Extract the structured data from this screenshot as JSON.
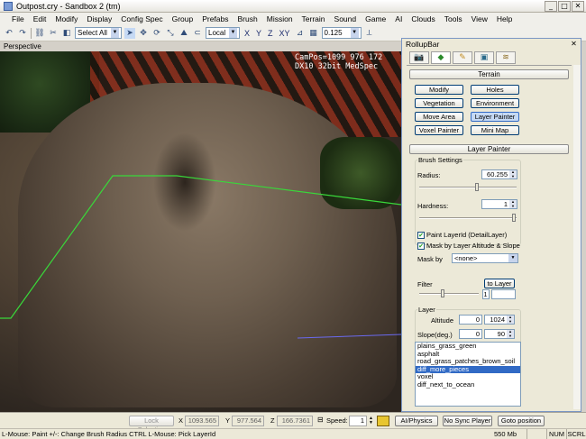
{
  "window": {
    "title": "Outpost.cry - Sandbox 2 (tm)",
    "minimize": "_",
    "maximize": "□",
    "close": "✕"
  },
  "menu": [
    "File",
    "Edit",
    "Modify",
    "Display",
    "Config Spec",
    "Group",
    "Prefabs",
    "Brush",
    "Mission",
    "Terrain",
    "Sound",
    "Game",
    "AI",
    "Clouds",
    "Tools",
    "View",
    "Help"
  ],
  "toolbar": {
    "selection": "Select All",
    "coord_space": "Local",
    "axes": [
      "X",
      "Y",
      "Z",
      "XY"
    ],
    "grid_value": "0.125"
  },
  "viewport": {
    "label": "Perspective",
    "camera_line1": "CamPos=1099 976 172",
    "camera_line2": "DX10 32bit MedSpec"
  },
  "rollup": {
    "title": "RollupBar",
    "close": "✕",
    "terrain_header": "Terrain",
    "terrain_buttons": [
      "Modify",
      "Holes",
      "Vegetation",
      "Environment",
      "Move Area",
      "Layer Painter",
      "Voxel Painter",
      "Mini Map"
    ],
    "layer_painter_header": "Layer Painter",
    "brush_settings": "Brush Settings",
    "radius_label": "Radius:",
    "radius_value": "60.255",
    "radius_level": 0.6,
    "hardness_label": "Hardness:",
    "hardness_value": "1",
    "hardness_level": 1.0,
    "paint_layer_id": "Paint LayerId (DetailLayer)",
    "mask_by_altitude": "Mask by Layer Altitude & Slope",
    "mask_by_label": "Mask by",
    "mask_by_value": "<none>",
    "filter_label": "Filter",
    "to_layer_button": "to Layer",
    "filter_value": "1",
    "filter_level": 0.4,
    "layer_label": "Layer",
    "altitude_label": "Altitude",
    "altitude_min": "0",
    "altitude_max": "1024",
    "slope_label": "Slope(deg.)",
    "slope_min": "0",
    "slope_max": "90",
    "layers": [
      "plains_grass_green",
      "asphalt",
      "road_grass_patches_brown_soil",
      "diff_more_pieces",
      "voxel",
      "diff_next_to_ocean"
    ],
    "selected_layer": "diff_more_pieces"
  },
  "statusrow": {
    "lock_selection": "Lock Selection",
    "x_label": "X",
    "x_value": "1093.565",
    "y_label": "Y",
    "y_value": "977.564",
    "z_label": "Z",
    "z_value": "166.7361",
    "speed_label": "Speed:",
    "speed_value": "1",
    "ai_physics": "AI/Physics",
    "no_sync_player": "No Sync Player",
    "goto_position": "Goto position"
  },
  "statusbar": {
    "hint": "L-Mouse: Paint   +/-: Change Brush Radius   CTRL L-Mouse: Pick LayerId",
    "memory": "550 Mb",
    "num": "NUM",
    "scrl": "SCRL"
  },
  "colors": {
    "selection_blue": "#316ac5",
    "terrain_outline": "#39d83a"
  }
}
